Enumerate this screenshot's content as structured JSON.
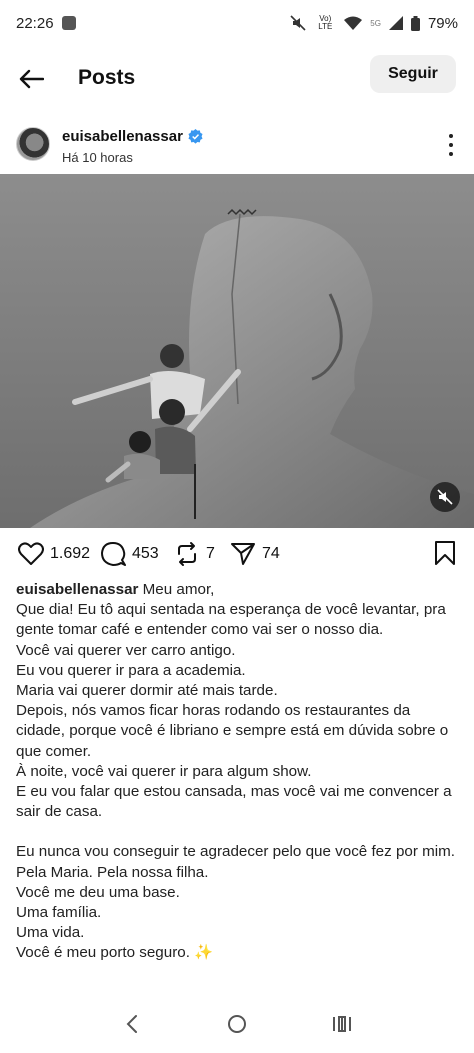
{
  "status_bar": {
    "time": "22:26",
    "network_label": "Vo) LTE",
    "signal_label": "5G",
    "battery": "79%"
  },
  "header": {
    "title": "Posts",
    "follow_label": "Seguir"
  },
  "post": {
    "username": "euisabellenassar",
    "time_ago": "Há 10 horas",
    "likes": "1.692",
    "comments": "453",
    "reposts": "7",
    "shares": "74",
    "caption_user": "euisabellenassar",
    "caption_first": "Meu amor,",
    "caption_lines": [
      "Que dia! Eu tô aqui sentada na esperança de você levantar, pra gente tomar café e entender como vai ser o nosso dia.",
      "Você vai querer ver carro antigo.",
      "Eu vou querer ir para a academia.",
      "Maria vai querer dormir até mais tarde.",
      "Depois, nós vamos ficar horas rodando os restaurantes da cidade, porque você é libriano e sempre está em dúvida sobre o que comer.",
      "À noite, você vai querer ir para algum show.",
      "E eu vou falar que estou cansada, mas você vai me convencer a sair de casa.",
      "",
      "Eu nunca vou conseguir te agradecer pelo que você fez por mim.",
      "Pela Maria. Pela nossa filha.",
      "Você me deu uma base.",
      "Uma família.",
      "Uma vida.",
      "Você é meu porto seguro. ✨"
    ]
  },
  "icons": {
    "back": "arrow-left-icon",
    "verified": "verified-badge-icon",
    "more": "more-vertical-icon",
    "mute": "sound-off-icon",
    "like": "heart-icon",
    "comment": "comment-icon",
    "repost": "repost-icon",
    "share": "send-icon",
    "save": "bookmark-icon"
  },
  "colors": {
    "verified": "#3897f0",
    "follow_bg": "#efefef"
  }
}
